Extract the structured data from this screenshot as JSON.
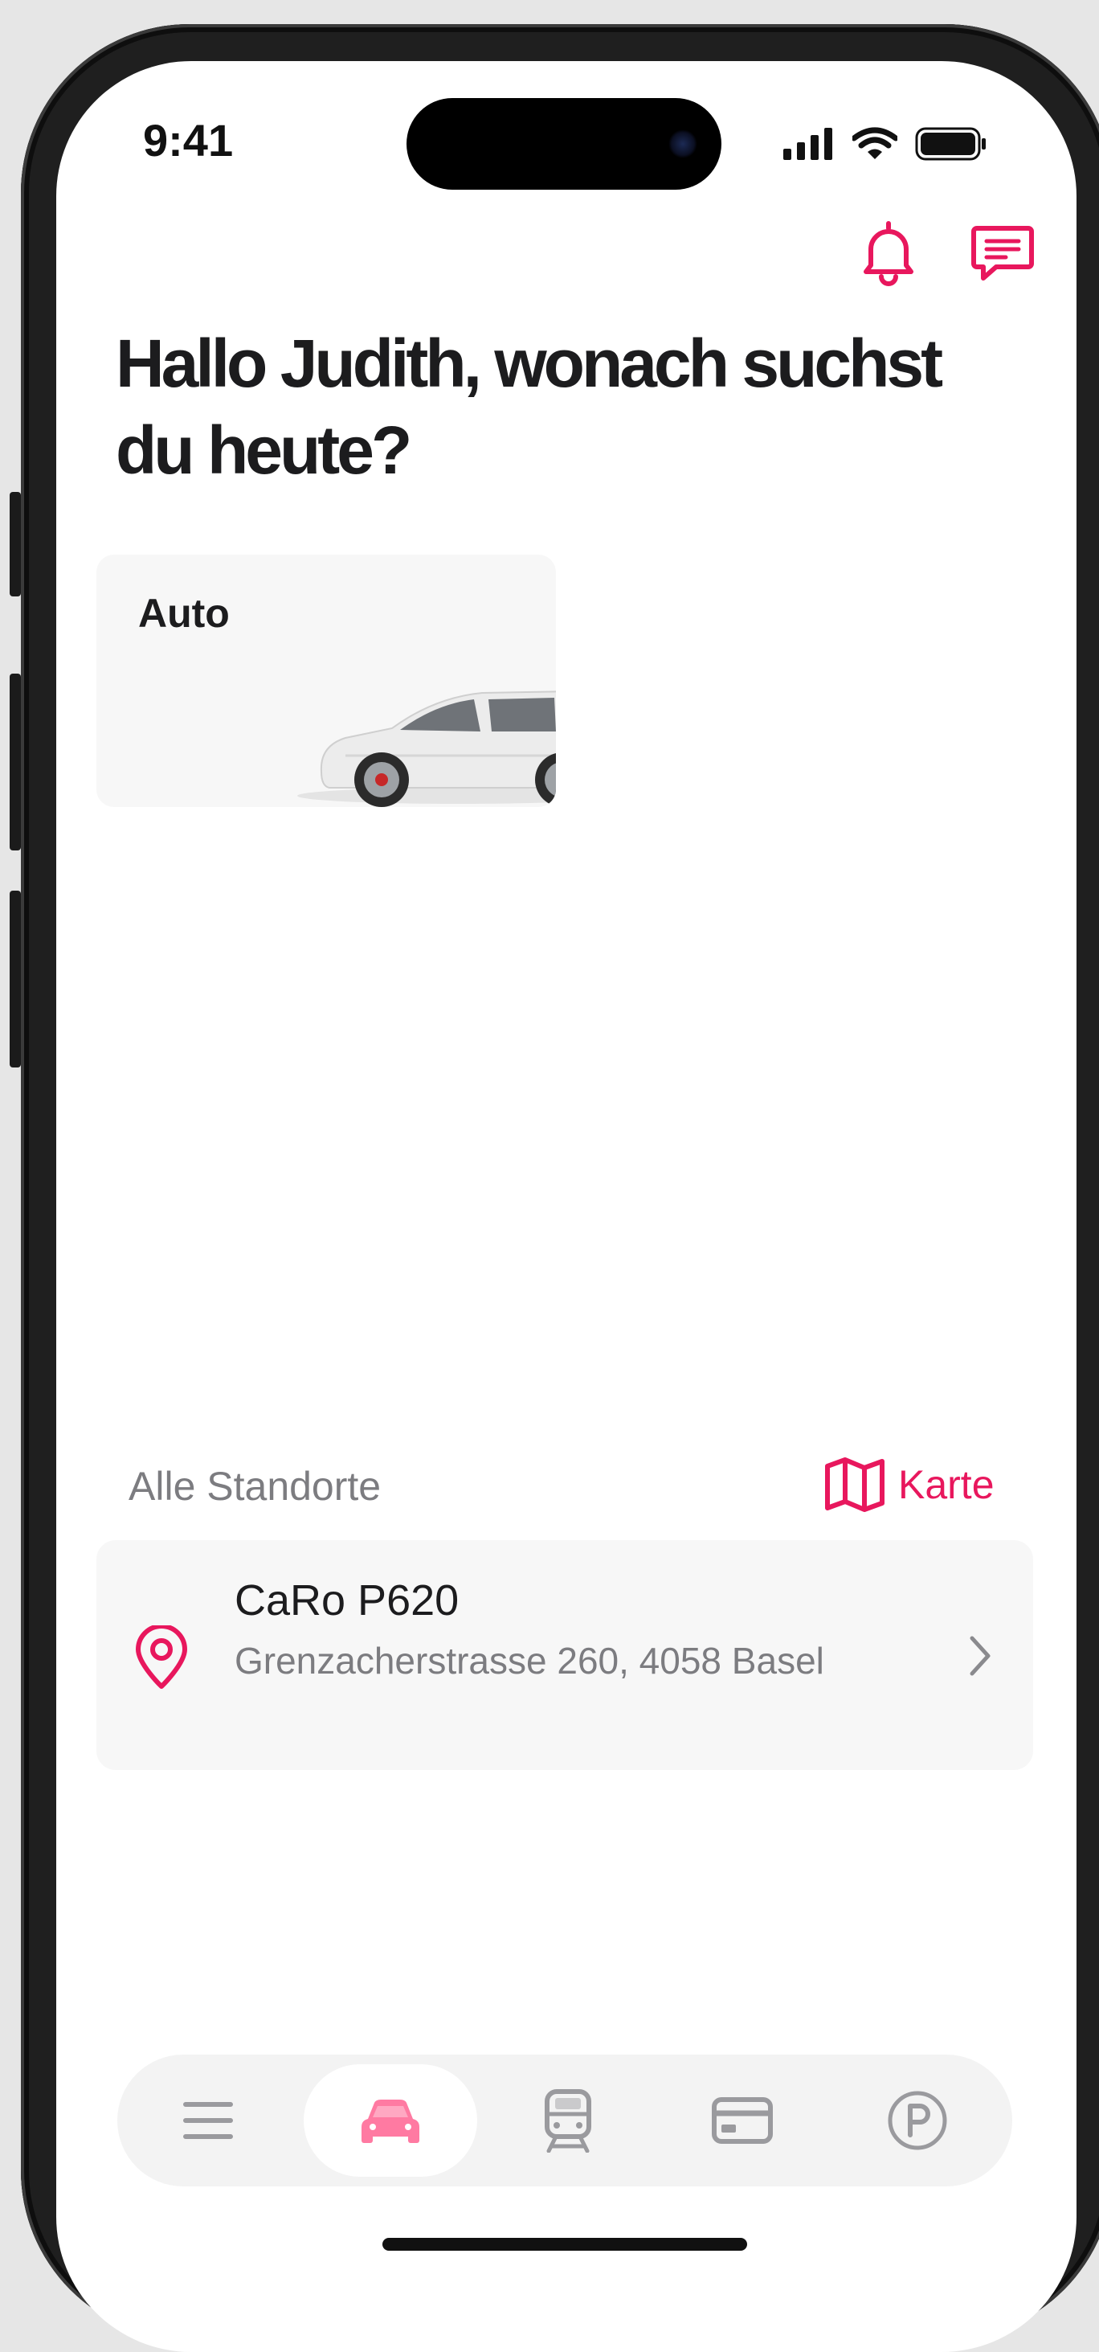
{
  "status_bar": {
    "time": "9:41",
    "icons": [
      "signal-icon",
      "wifi-icon",
      "battery-icon"
    ]
  },
  "header": {
    "icons": [
      "bell-icon",
      "chat-icon"
    ]
  },
  "greeting": "Hallo Judith, wonach suchst du heute?",
  "categories": [
    {
      "label": "Auto",
      "image": "white-car"
    }
  ],
  "locations_section": {
    "title": "Alle Standorte",
    "map_link": "Karte",
    "map_icon": "map-icon"
  },
  "locations": [
    {
      "name": "CaRo P620",
      "address": "Grenzacherstrasse 260, 4058 Basel",
      "icon": "location-pin-icon"
    }
  ],
  "tab_bar": {
    "tabs": [
      {
        "icon": "menu-icon",
        "active": false
      },
      {
        "icon": "car-icon",
        "active": true
      },
      {
        "icon": "train-icon",
        "active": false
      },
      {
        "icon": "card-icon",
        "active": false
      },
      {
        "icon": "parking-icon",
        "active": false
      }
    ]
  },
  "colors": {
    "accent": "#e8175d",
    "tab_active": "#ff7aa2",
    "text_primary": "#1c1c1e",
    "text_secondary": "#7c7c80",
    "card_bg": "#f7f7f7",
    "icon_gray": "#9a9a9e"
  }
}
